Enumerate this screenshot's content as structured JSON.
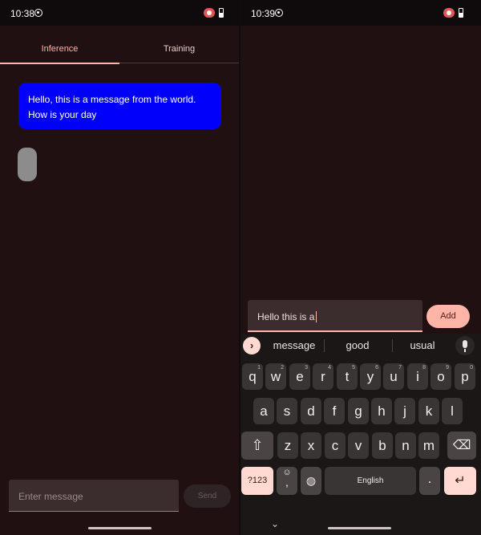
{
  "left_screen": {
    "status": {
      "time": "10:38"
    },
    "tabs": [
      {
        "label": "Inference",
        "active": true
      },
      {
        "label": "Training",
        "active": false
      }
    ],
    "messages": [
      {
        "text": "Hello, this is a message from the world. How is your day",
        "color": "#0000fb"
      }
    ],
    "typing_indicator_color": "#8c8c8c",
    "composer": {
      "placeholder": "Enter message",
      "send_label": "Send"
    }
  },
  "right_screen": {
    "status": {
      "time": "10:39"
    },
    "input": {
      "value": "Hello this is a",
      "add_label": "Add"
    },
    "keyboard": {
      "suggestions": [
        "message",
        "good",
        "usual"
      ],
      "row1": [
        {
          "k": "q",
          "h": "1"
        },
        {
          "k": "w",
          "h": "2"
        },
        {
          "k": "e",
          "h": "3"
        },
        {
          "k": "r",
          "h": "4"
        },
        {
          "k": "t",
          "h": "5"
        },
        {
          "k": "y",
          "h": "6"
        },
        {
          "k": "u",
          "h": "7"
        },
        {
          "k": "i",
          "h": "8"
        },
        {
          "k": "o",
          "h": "9"
        },
        {
          "k": "p",
          "h": "0"
        }
      ],
      "row2": [
        "a",
        "s",
        "d",
        "f",
        "g",
        "h",
        "j",
        "k",
        "l"
      ],
      "row3": [
        "z",
        "x",
        "c",
        "v",
        "b",
        "n",
        "m"
      ],
      "symbols_label": "?123",
      "comma_label": ",",
      "emoji_label": "☺",
      "space_label": "English",
      "period_label": ".",
      "collapse_icon": "chevron-down-icon"
    }
  },
  "colors": {
    "background": "#211012",
    "accent": "#ffb4a8",
    "bubble": "#0000fb"
  }
}
